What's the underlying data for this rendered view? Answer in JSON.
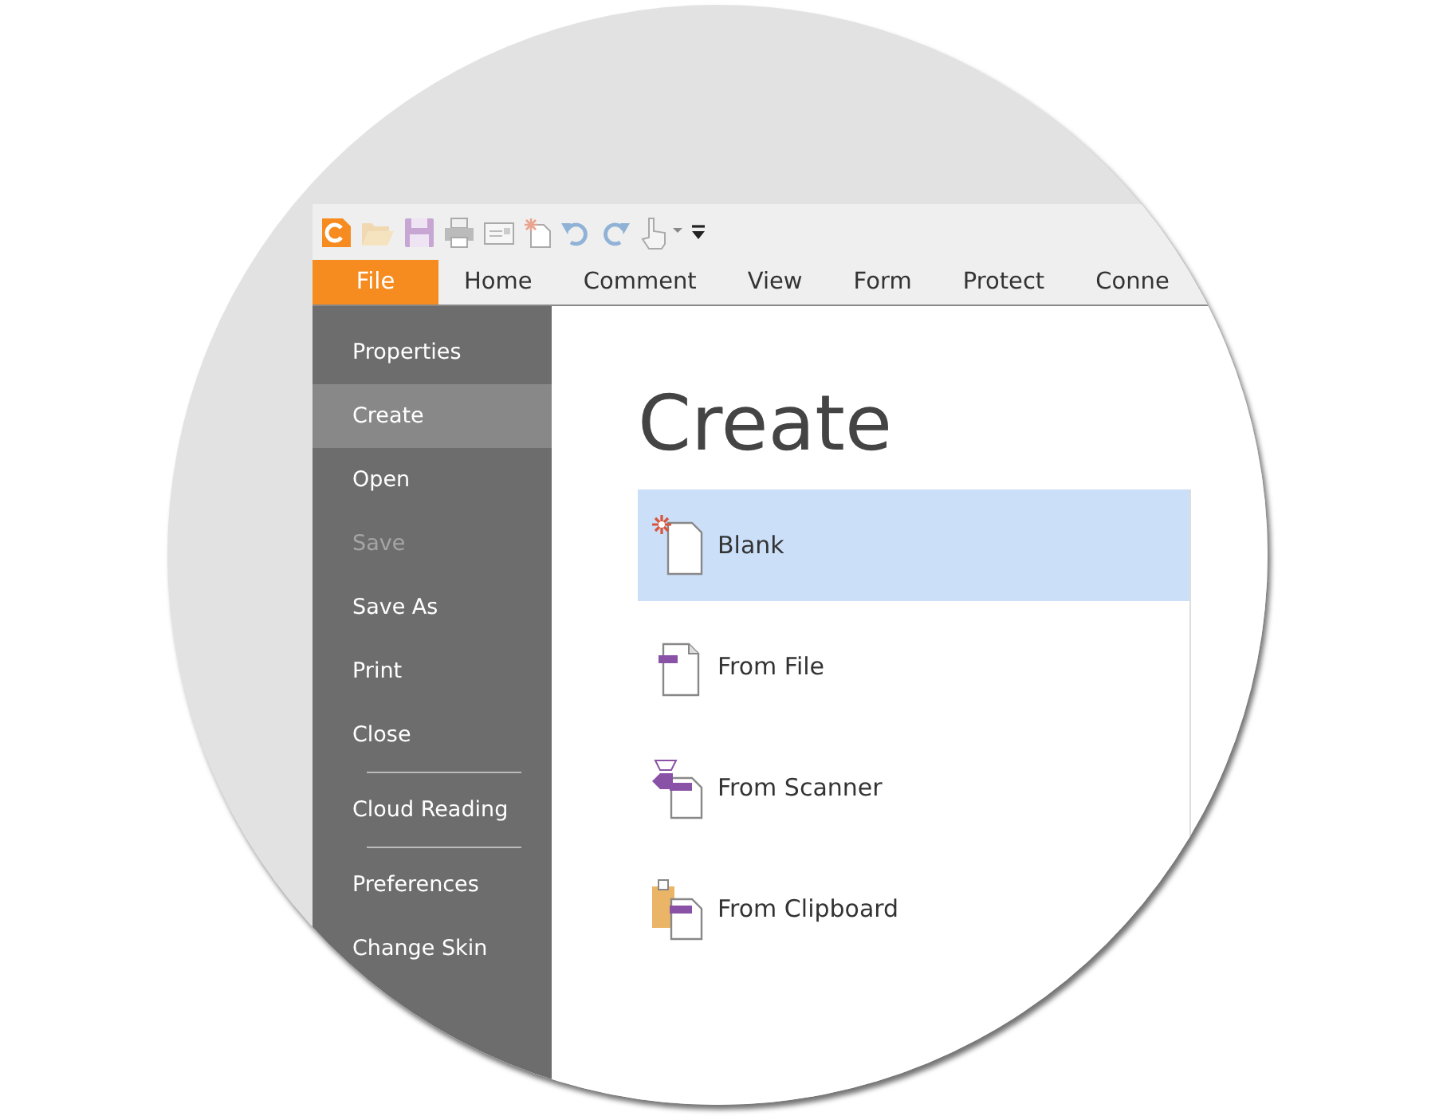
{
  "ribbon_tabs": [
    {
      "label": "File",
      "selected": true
    },
    {
      "label": "Home",
      "selected": false
    },
    {
      "label": "Comment",
      "selected": false
    },
    {
      "label": "View",
      "selected": false
    },
    {
      "label": "Form",
      "selected": false
    },
    {
      "label": "Protect",
      "selected": false
    },
    {
      "label": "Conne",
      "selected": false
    }
  ],
  "sidebar": {
    "items": [
      {
        "kind": "item",
        "label": "Properties",
        "selected": false,
        "disabled": false
      },
      {
        "kind": "item",
        "label": "Create",
        "selected": true,
        "disabled": false
      },
      {
        "kind": "item",
        "label": "Open",
        "selected": false,
        "disabled": false
      },
      {
        "kind": "item",
        "label": "Save",
        "selected": false,
        "disabled": true
      },
      {
        "kind": "item",
        "label": "Save As",
        "selected": false,
        "disabled": false
      },
      {
        "kind": "item",
        "label": "Print",
        "selected": false,
        "disabled": false
      },
      {
        "kind": "item",
        "label": "Close",
        "selected": false,
        "disabled": false
      },
      {
        "kind": "divider"
      },
      {
        "kind": "item",
        "label": "Cloud Reading",
        "selected": false,
        "disabled": false
      },
      {
        "kind": "divider"
      },
      {
        "kind": "item",
        "label": "Preferences",
        "selected": false,
        "disabled": false
      },
      {
        "kind": "item",
        "label": "Change Skin",
        "selected": false,
        "disabled": false
      }
    ]
  },
  "content": {
    "title": "Create",
    "options": [
      {
        "kind": "blank",
        "label": "Blank",
        "selected": true
      },
      {
        "kind": "file",
        "label": "From File",
        "selected": false
      },
      {
        "kind": "scanner",
        "label": "From Scanner",
        "selected": false
      },
      {
        "kind": "clipboard",
        "label": "From Clipboard",
        "selected": false
      }
    ]
  }
}
